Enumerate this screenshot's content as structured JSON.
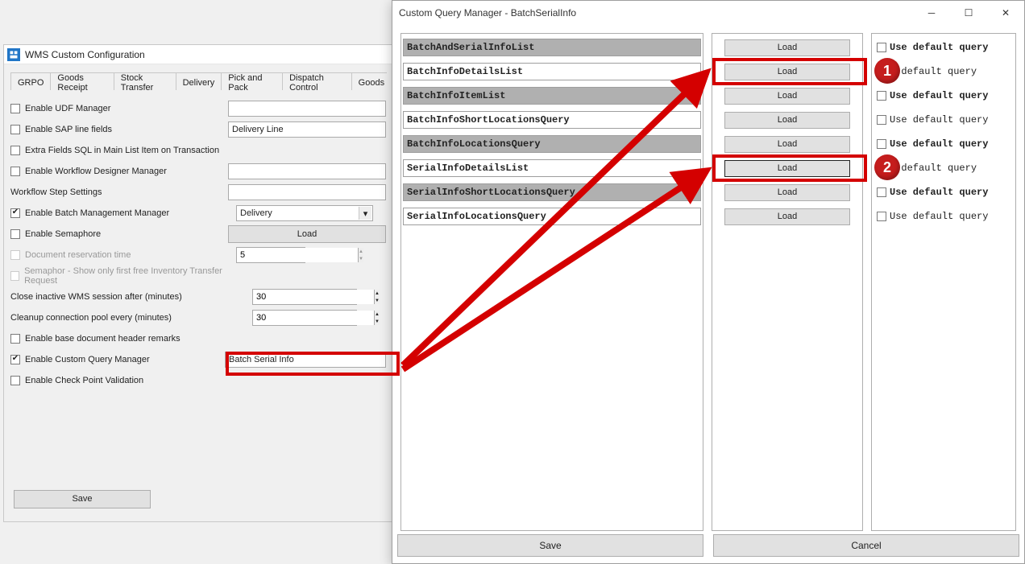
{
  "config": {
    "title": "WMS Custom Configuration",
    "tabs": [
      "GRPO",
      "Goods Receipt",
      "Stock Transfer",
      "Delivery",
      "Pick and Pack",
      "Dispatch Control",
      "Goods"
    ],
    "udf_label": "Enable UDF Manager",
    "sapline_label": "Enable SAP line fields",
    "sapline_value": "Delivery Line",
    "extrafields_label": "Extra Fields SQL in Main List Item on Transaction",
    "workflowmgr_label": "Enable Workflow Designer Manager",
    "workflowstep_label": "Workflow Step Settings",
    "batchmgmt_label": "Enable Batch Management Manager",
    "batchmgmt_value": "Delivery",
    "semaphore_label": "Enable Semaphore",
    "load_btn": "Load",
    "docres_label": "Document reservation time",
    "docres_value": "5",
    "semaphor_free_label": "Semaphor - Show only first free Inventory Transfer Request",
    "closeinactive_label": "Close inactive WMS session after (minutes)",
    "closeinactive_value": "30",
    "cleanup_label": "Cleanup connection pool every (minutes)",
    "cleanup_value": "30",
    "basedoc_label": "Enable base document header remarks",
    "cqm_label": "Enable Custom Query Manager",
    "cqm_value": "Batch Serial Info",
    "checkpoint_label": "Enable Check Point Validation",
    "save": "Save"
  },
  "cqm": {
    "title": "Custom Query Manager - BatchSerialInfo",
    "rows": [
      {
        "name": "BatchAndSerialInfoList",
        "header": true,
        "load": "Load",
        "default": "Use default query",
        "def_bold": true
      },
      {
        "name": "BatchInfoDetailsList",
        "header": false,
        "load": "Load",
        "default": "e default query",
        "def_bold": false
      },
      {
        "name": "BatchInfoItemList",
        "header": true,
        "load": "Load",
        "default": "Use default query",
        "def_bold": true
      },
      {
        "name": "BatchInfoShortLocationsQuery",
        "header": false,
        "load": "Load",
        "default": "Use default query",
        "def_bold": false
      },
      {
        "name": "BatchInfoLocationsQuery",
        "header": true,
        "load": "Load",
        "default": "Use default query",
        "def_bold": true
      },
      {
        "name": "SerialInfoDetailsList",
        "header": false,
        "load": "Load",
        "default": "e default query",
        "def_bold": false
      },
      {
        "name": "SerialInfoShortLocationsQuery",
        "header": true,
        "load": "Load",
        "default": "Use default query",
        "def_bold": true
      },
      {
        "name": "SerialInfoLocationsQuery",
        "header": false,
        "load": "Load",
        "default": "Use default query",
        "def_bold": false
      }
    ],
    "footer_save": "Save",
    "footer_cancel": "Cancel"
  },
  "annot": {
    "b1": "1",
    "b2": "2"
  }
}
